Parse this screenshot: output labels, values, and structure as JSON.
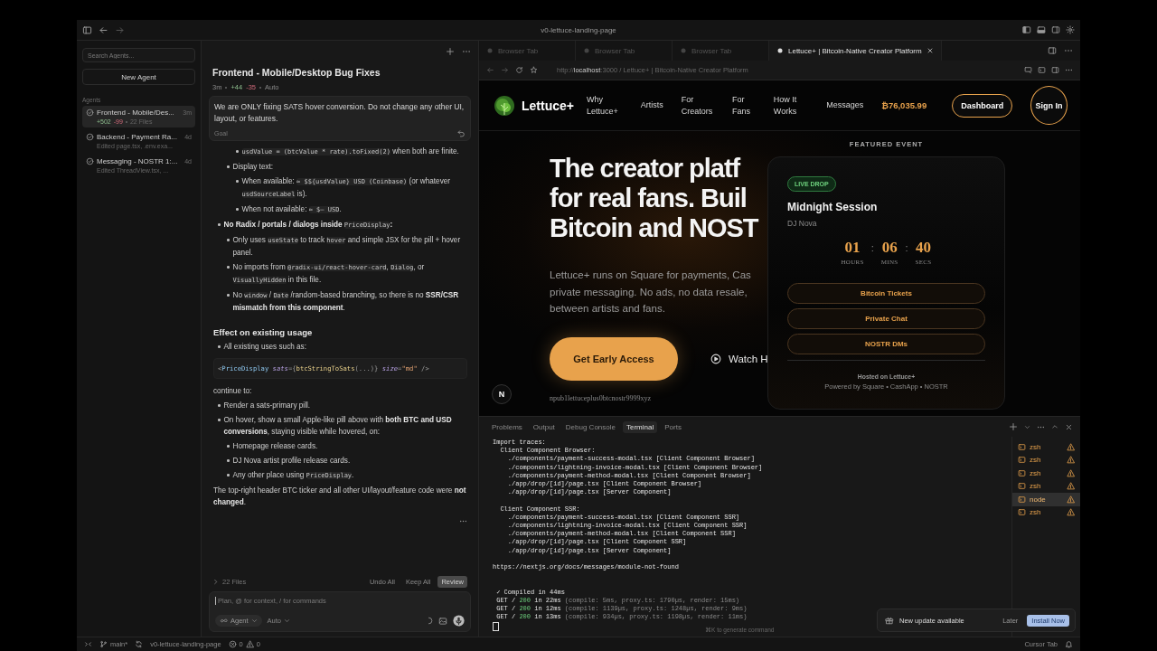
{
  "window": {
    "title": "v0-lettuce-landing-page"
  },
  "sidebar": {
    "search": {
      "placeholder": "Search Agents..."
    },
    "new_button": "New Agent",
    "section": "Agents",
    "agents": [
      {
        "kind": "diff",
        "title": "Frontend - Mobile/Des...",
        "age": "3m",
        "added": "+502",
        "removed": "-99",
        "files": "22 Files",
        "selected": true
      },
      {
        "kind": "edited",
        "title": "Backend - Payment Ra...",
        "age": "4d",
        "note": "Edited page.tsx, .env.exa...",
        "selected": false
      },
      {
        "kind": "edited",
        "title": "Messaging - NOSTR 1:...",
        "age": "4d",
        "note": "Edited ThreadView.tsx, ...",
        "selected": false
      }
    ]
  },
  "chat": {
    "title": "Frontend - Mobile/Desktop Bug Fixes",
    "age": "3m",
    "added": "+44",
    "removed": "-35",
    "mode": "Auto",
    "prompt": {
      "text": "We are ONLY fixing SATS hover conversion. Do not change any other UI, layout, or features.",
      "goal": "Goal"
    },
    "blocks": [
      {
        "kind": "continued",
        "children": [
          {
            "kind": "continued",
            "children": [
              {
                "kind": "bullet",
                "segs": [
                  {
                    "kind": "code",
                    "text": "usdValue = (btcValue * rate).toFixed(2)"
                  },
                  {
                    "kind": "plain",
                    "text": " when both are finite."
                  }
                ]
              }
            ]
          },
          {
            "kind": "bullet",
            "segs": [
              {
                "kind": "plain",
                "text": "Display text:"
              }
            ],
            "children": [
              {
                "kind": "bullet",
                "segs": [
                  {
                    "kind": "plain",
                    "text": "When available: "
                  },
                  {
                    "kind": "code",
                    "text": "≈ $${usdValue} USD (Coinbase)"
                  },
                  {
                    "kind": "plain",
                    "text": " (or whatever "
                  },
                  {
                    "kind": "code",
                    "text": "usdSourceLabel"
                  },
                  {
                    "kind": "plain",
                    "text": " is)."
                  }
                ]
              },
              {
                "kind": "bullet",
                "segs": [
                  {
                    "kind": "plain",
                    "text": "When not available: "
                  },
                  {
                    "kind": "code",
                    "text": "≈ $– USD"
                  },
                  {
                    "kind": "plain",
                    "text": "."
                  }
                ]
              }
            ]
          }
        ]
      },
      {
        "kind": "bullet",
        "segs": [
          {
            "kind": "bold",
            "text": "No Radix / portals / dialogs inside "
          },
          {
            "kind": "code",
            "text": "PriceDisplay"
          },
          {
            "kind": "bold",
            "text": ":"
          }
        ],
        "children": [
          {
            "kind": "bullet",
            "segs": [
              {
                "kind": "plain",
                "text": "Only uses "
              },
              {
                "kind": "code",
                "text": "useState"
              },
              {
                "kind": "plain",
                "text": " to track "
              },
              {
                "kind": "code",
                "text": "hover"
              },
              {
                "kind": "plain",
                "text": " and simple JSX for the pill + hover panel."
              }
            ]
          },
          {
            "kind": "bullet",
            "segs": [
              {
                "kind": "plain",
                "text": "No imports from "
              },
              {
                "kind": "code",
                "text": "@radix-ui/react-hover-card"
              },
              {
                "kind": "plain",
                "text": ", "
              },
              {
                "kind": "code",
                "text": "Dialog"
              },
              {
                "kind": "plain",
                "text": ", or "
              },
              {
                "kind": "code",
                "text": "VisuallyHidden"
              },
              {
                "kind": "plain",
                "text": " in this file."
              }
            ]
          },
          {
            "kind": "bullet",
            "segs": [
              {
                "kind": "plain",
                "text": "No "
              },
              {
                "kind": "code",
                "text": "window"
              },
              {
                "kind": "plain",
                "text": " / "
              },
              {
                "kind": "code",
                "text": "Date"
              },
              {
                "kind": "plain",
                "text": " /random-based branching, so there is no "
              },
              {
                "kind": "bold",
                "text": "SSR/CSR mismatch from this component"
              },
              {
                "kind": "plain",
                "text": "."
              }
            ]
          }
        ]
      },
      {
        "kind": "heading",
        "text": "Effect on existing usage"
      },
      {
        "kind": "bullet",
        "segs": [
          {
            "kind": "plain",
            "text": "All existing uses such as:"
          }
        ]
      },
      {
        "kind": "codeblock",
        "segs": [
          {
            "kind": "punct",
            "text": "<"
          },
          {
            "kind": "tag",
            "text": "PriceDisplay"
          },
          {
            "kind": "attr",
            "text": " sats"
          },
          {
            "kind": "punct",
            "text": "={"
          },
          {
            "kind": "fn",
            "text": "btcStringToSats"
          },
          {
            "kind": "punct",
            "text": "(...)} "
          },
          {
            "kind": "attr",
            "text": "size"
          },
          {
            "kind": "punct",
            "text": "="
          },
          {
            "kind": "str",
            "text": "\"md\""
          },
          {
            "kind": "punct",
            "text": " />"
          }
        ]
      },
      {
        "kind": "para",
        "segs": [
          {
            "kind": "plain",
            "text": "continue to:"
          }
        ]
      },
      {
        "kind": "bullet",
        "segs": [
          {
            "kind": "plain",
            "text": "Render a sats-primary pill."
          }
        ]
      },
      {
        "kind": "bullet",
        "segs": [
          {
            "kind": "plain",
            "text": "On hover, show a small Apple-like pill above with "
          },
          {
            "kind": "bold",
            "text": "both BTC and USD conversions"
          },
          {
            "kind": "plain",
            "text": ", staying visible while hovered, on:"
          }
        ],
        "children": [
          {
            "kind": "bullet",
            "segs": [
              {
                "kind": "plain",
                "text": "Homepage release cards."
              }
            ]
          },
          {
            "kind": "bullet",
            "segs": [
              {
                "kind": "plain",
                "text": "DJ Nova artist profile release cards."
              }
            ]
          },
          {
            "kind": "bullet",
            "segs": [
              {
                "kind": "plain",
                "text": "Any other place using "
              },
              {
                "kind": "code",
                "text": "PriceDisplay"
              },
              {
                "kind": "plain",
                "text": "."
              }
            ]
          }
        ]
      },
      {
        "kind": "para",
        "segs": [
          {
            "kind": "plain",
            "text": "The top-right header BTC ticker and all other UI/layout/feature code were "
          },
          {
            "kind": "bold",
            "text": "not changed"
          },
          {
            "kind": "plain",
            "text": "."
          }
        ]
      }
    ],
    "files": "22 Files",
    "actions": [
      {
        "label": "Undo All",
        "selected": false
      },
      {
        "label": "Keep All",
        "selected": false
      },
      {
        "label": "Review",
        "selected": true
      }
    ],
    "input": {
      "placeholder": "Plan, @ for context, / for commands"
    },
    "agent_mode": "Agent",
    "model": "Auto"
  },
  "browser": {
    "tabs": [
      {
        "label": "Browser Tab",
        "selected": false
      },
      {
        "label": "Browser Tab",
        "selected": false
      },
      {
        "label": "Browser Tab",
        "selected": false
      },
      {
        "label": "Lettuce+ | Bitcoin-Native Creator Platform",
        "selected": true
      }
    ],
    "url": "http://**localhost**:3000 / Lettuce+ | Bitcoin-Native Creator Platform",
    "page": {
      "brand": "Lettuce+",
      "nav": [
        "Why Lettuce+",
        "Artists",
        "For Creators",
        "For Fans",
        "How It Works",
        "Messages"
      ],
      "price": "₿76,035.99",
      "buttons": [
        "Dashboard",
        "Sign In"
      ],
      "headline": [
        "The creator platf",
        "for real fans. Buil",
        "Bitcoin and NOST"
      ],
      "intro": [
        "Lettuce+ runs on Square for payments, Cas",
        "private messaging. No ads, no data resale,",
        "between artists and fans."
      ],
      "cta": "Get Early Access",
      "watch": "Watch H",
      "dev_badge": "N",
      "npub": "npub1lettuceplus0btcnostr9999xyz",
      "featured": {
        "label": "FEATURED EVENT",
        "badge": "LIVE DROP",
        "title": "Midnight Session",
        "artist": "DJ Nova",
        "separator": ":",
        "countdown": [
          {
            "value": "01",
            "unit": "HOURS"
          },
          {
            "value": "06",
            "unit": "MINS"
          },
          {
            "value": "40",
            "unit": "SECS"
          }
        ],
        "actions": [
          "Bitcoin Tickets",
          "Private Chat",
          "NOSTR DMs"
        ],
        "host": "Hosted on Lettuce+",
        "powered": "Powered by Square • CashApp • NOSTR"
      }
    }
  },
  "panel": {
    "tabs": [
      {
        "label": "Problems",
        "selected": false
      },
      {
        "label": "Output",
        "selected": false
      },
      {
        "label": "Debug Console",
        "selected": false
      },
      {
        "label": "Terminal",
        "selected": true
      },
      {
        "label": "Ports",
        "selected": false
      }
    ],
    "output": [
      {
        "lines": [
          [
            {
              "kind": "plain",
              "text": "Import traces:"
            }
          ],
          [
            {
              "kind": "plain",
              "text": "  Client Component Browser:"
            }
          ],
          [
            {
              "kind": "plain",
              "text": "    ./components/payment-success-modal.tsx [Client Component Browser]"
            }
          ],
          [
            {
              "kind": "plain",
              "text": "    ./components/lightning-invoice-modal.tsx [Client Component Browser]"
            }
          ],
          [
            {
              "kind": "plain",
              "text": "    ./components/payment-method-modal.tsx [Client Component Browser]"
            }
          ],
          [
            {
              "kind": "plain",
              "text": "    ./app/drop/[id]/page.tsx [Client Component Browser]"
            }
          ],
          [
            {
              "kind": "plain",
              "text": "    ./app/drop/[id]/page.tsx [Server Component]"
            }
          ]
        ]
      },
      {
        "lines": [
          [
            {
              "kind": "plain",
              "text": "  Client Component SSR:"
            }
          ],
          [
            {
              "kind": "plain",
              "text": "    ./components/payment-success-modal.tsx [Client Component SSR]"
            }
          ],
          [
            {
              "kind": "plain",
              "text": "    ./components/lightning-invoice-modal.tsx [Client Component SSR]"
            }
          ],
          [
            {
              "kind": "plain",
              "text": "    ./components/payment-method-modal.tsx [Client Component SSR]"
            }
          ],
          [
            {
              "kind": "plain",
              "text": "    ./app/drop/[id]/page.tsx [Client Component SSR]"
            }
          ],
          [
            {
              "kind": "plain",
              "text": "    ./app/drop/[id]/page.tsx [Server Component]"
            }
          ]
        ]
      },
      {
        "lines": [
          [
            {
              "kind": "plain",
              "text": "https://nextjs.org/docs/messages/module-not-found"
            }
          ]
        ]
      },
      {
        "lines": [
          [
            {
              "kind": "plain",
              "text": " ✓ Compiled in 44ms"
            }
          ],
          [
            {
              "kind": "plain",
              "text": " GET / "
            },
            {
              "kind": "ok",
              "text": "200"
            },
            {
              "kind": "plain",
              "text": " in 22ms "
            },
            {
              "kind": "dim",
              "text": "(compile: 5ms, proxy.ts: 1790µs, render: 15ms)"
            }
          ],
          [
            {
              "kind": "plain",
              "text": " GET / "
            },
            {
              "kind": "ok",
              "text": "200"
            },
            {
              "kind": "plain",
              "text": " in 12ms "
            },
            {
              "kind": "dim",
              "text": "(compile: 1139µs, proxy.ts: 1248µs, render: 9ms)"
            }
          ],
          [
            {
              "kind": "plain",
              "text": " GET / "
            },
            {
              "kind": "ok",
              "text": "200"
            },
            {
              "kind": "plain",
              "text": " in 13ms "
            },
            {
              "kind": "dim",
              "text": "(compile: 934µs, proxy.ts: 1198µs, render: 11ms)"
            }
          ]
        ]
      }
    ],
    "hint": "⌘K to generate command",
    "sessions": [
      {
        "name": "zsh",
        "selected": false
      },
      {
        "name": "zsh",
        "selected": false
      },
      {
        "name": "zsh",
        "selected": false
      },
      {
        "name": "zsh",
        "selected": false
      },
      {
        "name": "node",
        "selected": true
      },
      {
        "name": "zsh",
        "selected": false
      }
    ]
  },
  "toast": {
    "text": "New update available",
    "later": "Later",
    "install": "Install Now"
  },
  "status_bar": {
    "branch": "main*",
    "project": "v0-lettuce-landing-page",
    "errors": "0",
    "warnings": "0",
    "right": "Cursor Tab"
  }
}
